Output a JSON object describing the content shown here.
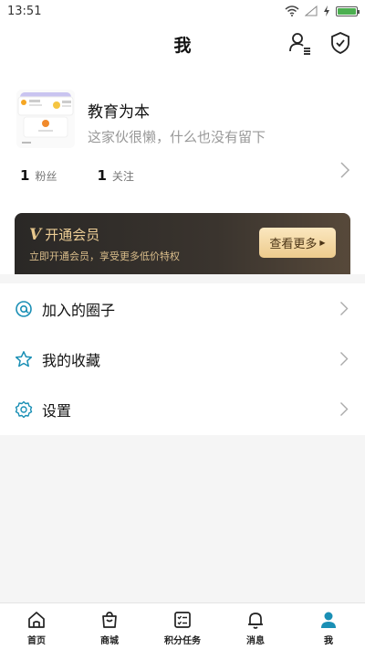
{
  "status_bar": {
    "time": "13:51"
  },
  "header": {
    "title": "我"
  },
  "profile": {
    "name": "教育为本",
    "bio": "这家伙很懒，什么也没有留下",
    "stats": [
      {
        "count": "1",
        "label": "粉丝"
      },
      {
        "count": "1",
        "label": "关注"
      }
    ]
  },
  "vip": {
    "icon": "V",
    "title": "开通会员",
    "subtitle": "立即开通会员，享受更多低价特权",
    "button": "查看更多"
  },
  "menu": [
    {
      "label": "加入的圈子",
      "icon": "circle-at-icon"
    },
    {
      "label": "我的收藏",
      "icon": "star-icon"
    },
    {
      "label": "设置",
      "icon": "gear-icon"
    }
  ],
  "tabs": [
    {
      "label": "首页",
      "icon": "home-icon"
    },
    {
      "label": "商城",
      "icon": "shopping-bag-icon"
    },
    {
      "label": "积分任务",
      "icon": "task-list-icon"
    },
    {
      "label": "消息",
      "icon": "bell-icon"
    },
    {
      "label": "我",
      "icon": "person-icon",
      "active": true
    }
  ],
  "colors": {
    "accent": "#1a8fb5",
    "vip_gold": "#eccd95",
    "vip_dark": "#2a2826"
  }
}
